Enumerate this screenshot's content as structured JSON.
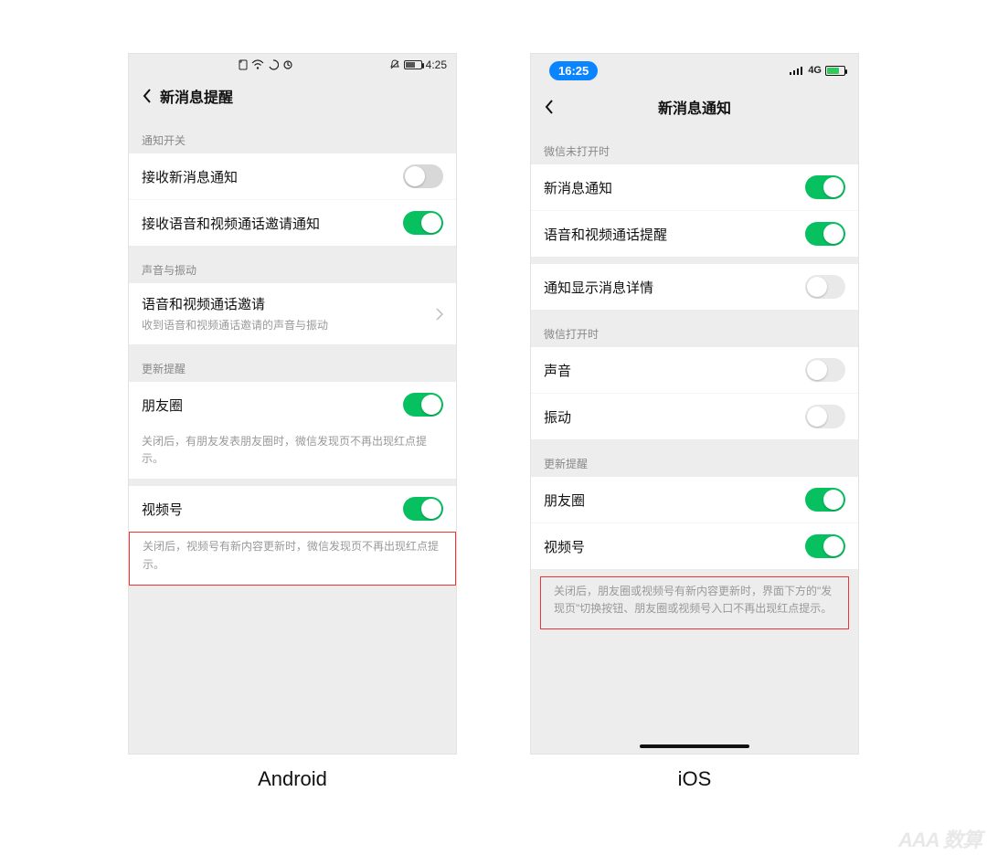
{
  "captions": {
    "android": "Android",
    "ios": "iOS"
  },
  "android": {
    "status": {
      "time": "4:25"
    },
    "nav": {
      "title": "新消息提醒"
    },
    "sections": {
      "s1_header": "通知开关",
      "s2_header": "声音与振动",
      "s3_header": "更新提醒"
    },
    "rows": {
      "receive_msg": {
        "label": "接收新消息通知",
        "on": false
      },
      "receive_call": {
        "label": "接收语音和视频通话邀请通知",
        "on": true
      },
      "call_invite": {
        "label": "语音和视频通话邀请",
        "sub": "收到语音和视频通话邀请的声音与振动"
      },
      "moments": {
        "label": "朋友圈",
        "on": true,
        "desc": "关闭后，有朋友发表朋友圈时，微信发现页不再出现红点提示。"
      },
      "channels": {
        "label": "视频号",
        "on": true,
        "desc": "关闭后，视频号有新内容更新时，微信发现页不再出现红点提示。"
      }
    }
  },
  "ios": {
    "status": {
      "time": "16:25",
      "network": "4G"
    },
    "nav": {
      "title": "新消息通知"
    },
    "sections": {
      "s1_header": "微信未打开时",
      "s2_header": "微信打开时",
      "s3_header": "更新提醒"
    },
    "rows": {
      "new_msg": {
        "label": "新消息通知",
        "on": true
      },
      "call": {
        "label": "语音和视频通话提醒",
        "on": true
      },
      "detail": {
        "label": "通知显示消息详情",
        "on": false
      },
      "sound": {
        "label": "声音",
        "on": false
      },
      "vibrate": {
        "label": "振动",
        "on": false
      },
      "moments": {
        "label": "朋友圈",
        "on": true
      },
      "channels": {
        "label": "视频号",
        "on": true
      }
    },
    "footer_desc": "关闭后，朋友圈或视频号有新内容更新时，界面下方的\"发现页\"切换按钮、朋友圈或视频号入口不再出现红点提示。"
  },
  "watermark": "AAA 数算"
}
